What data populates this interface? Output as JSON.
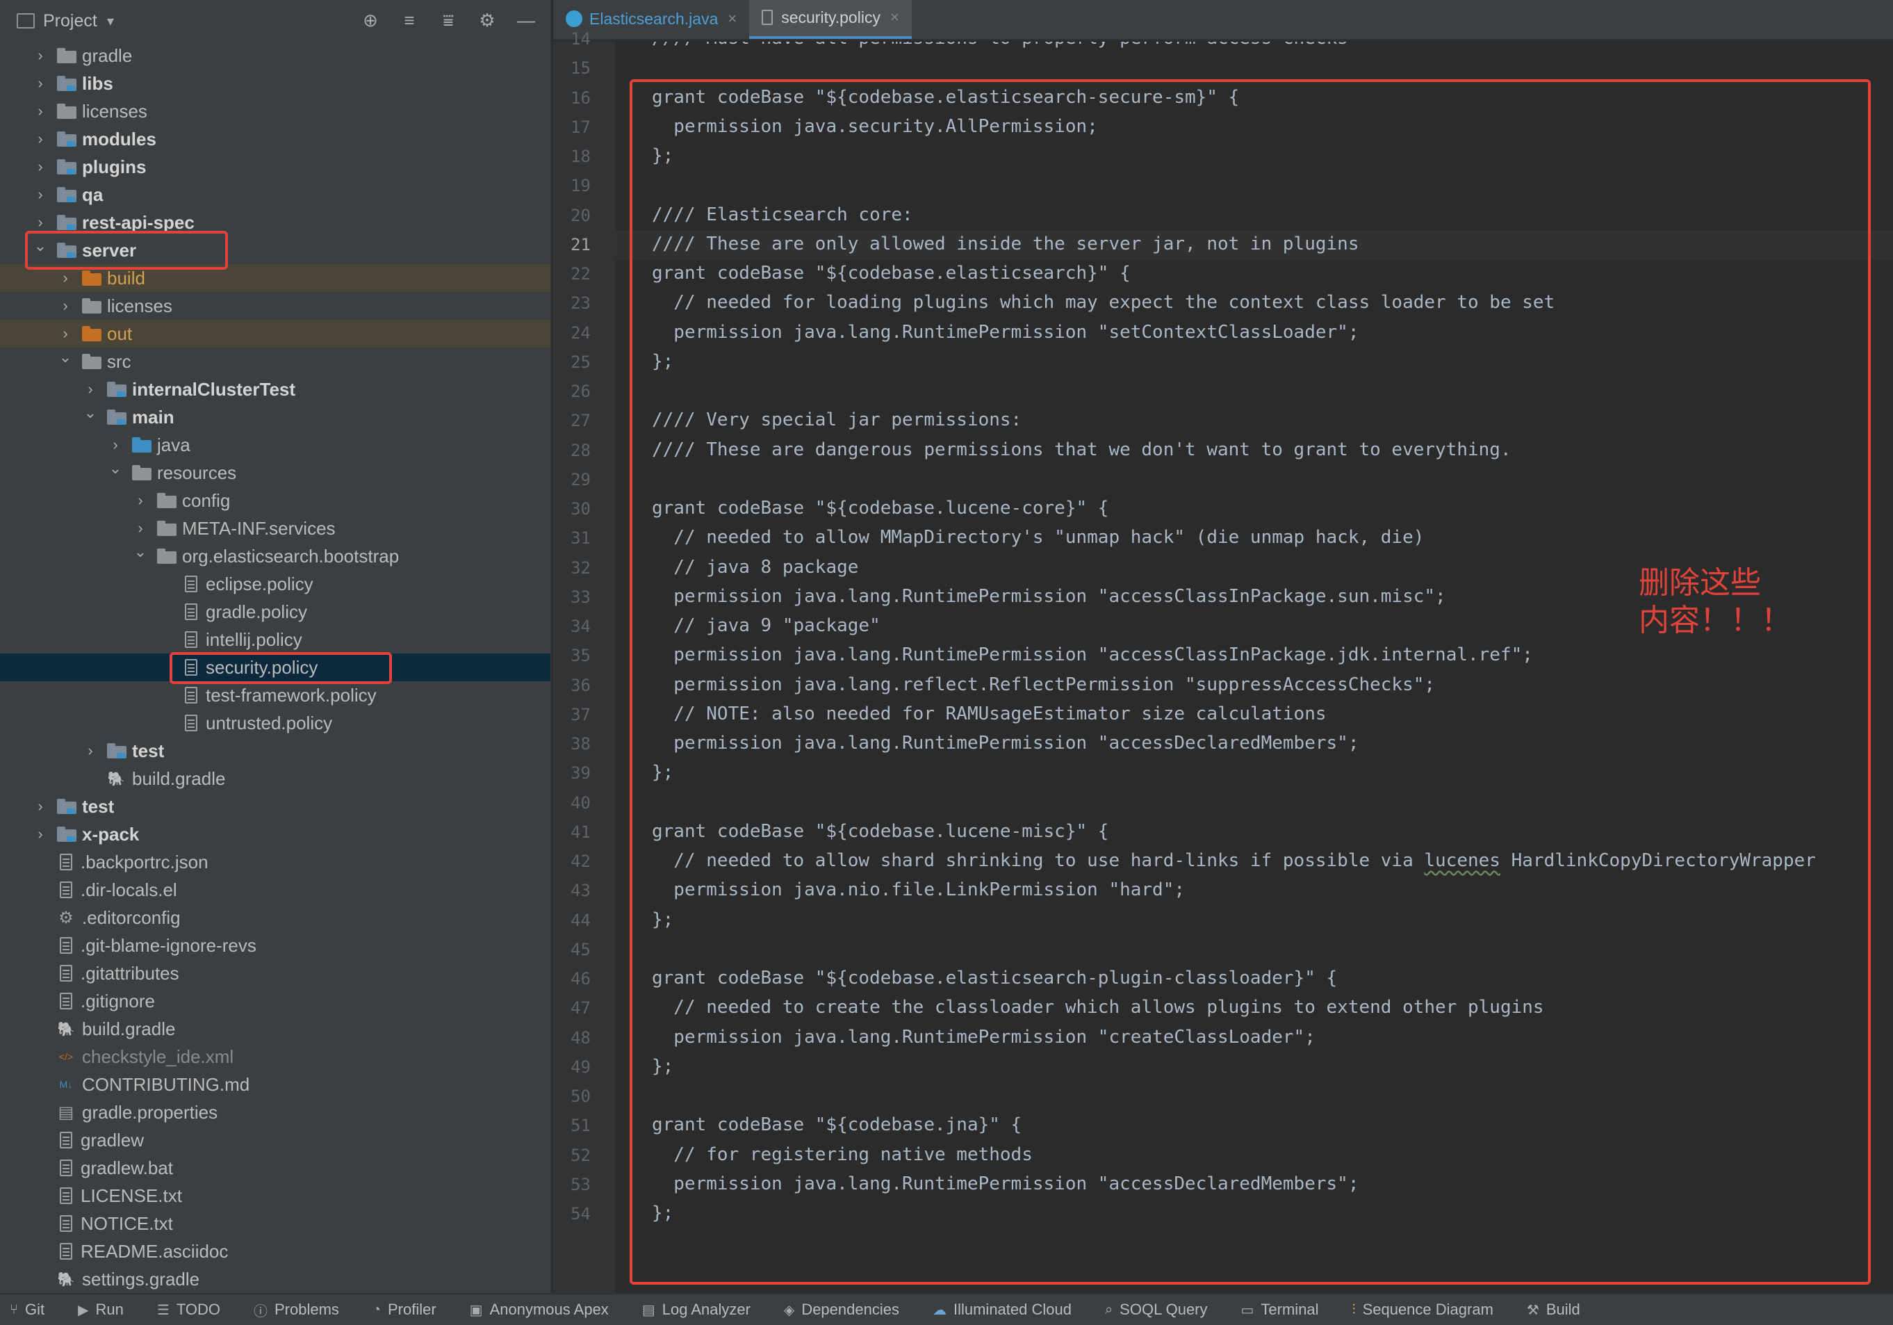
{
  "project_panel": {
    "title": "Project",
    "tree": [
      {
        "label": "gradle",
        "depth": 0,
        "kind": "folder",
        "expand": "closed"
      },
      {
        "label": "libs",
        "depth": 0,
        "kind": "module",
        "expand": "closed",
        "bold": true
      },
      {
        "label": "licenses",
        "depth": 0,
        "kind": "folder",
        "expand": "closed"
      },
      {
        "label": "modules",
        "depth": 0,
        "kind": "module",
        "expand": "closed",
        "bold": true
      },
      {
        "label": "plugins",
        "depth": 0,
        "kind": "module",
        "expand": "closed",
        "bold": true
      },
      {
        "label": "qa",
        "depth": 0,
        "kind": "module",
        "expand": "closed",
        "bold": true
      },
      {
        "label": "rest-api-spec",
        "depth": 0,
        "kind": "module",
        "expand": "closed",
        "bold": true
      },
      {
        "label": "server",
        "depth": 0,
        "kind": "module",
        "expand": "open",
        "bold": true
      },
      {
        "label": "build",
        "depth": 1,
        "kind": "orange",
        "expand": "closed",
        "excluded": true
      },
      {
        "label": "licenses",
        "depth": 1,
        "kind": "folder",
        "expand": "closed"
      },
      {
        "label": "out",
        "depth": 1,
        "kind": "orange",
        "expand": "closed",
        "excluded": true
      },
      {
        "label": "src",
        "depth": 1,
        "kind": "folder",
        "expand": "open"
      },
      {
        "label": "internalClusterTest",
        "depth": 2,
        "kind": "module",
        "expand": "closed",
        "bold": true
      },
      {
        "label": "main",
        "depth": 2,
        "kind": "module",
        "expand": "open",
        "bold": true
      },
      {
        "label": "java",
        "depth": 3,
        "kind": "blue",
        "expand": "closed"
      },
      {
        "label": "resources",
        "depth": 3,
        "kind": "folder",
        "expand": "open"
      },
      {
        "label": "config",
        "depth": 4,
        "kind": "folder",
        "expand": "closed"
      },
      {
        "label": "META-INF.services",
        "depth": 4,
        "kind": "folder",
        "expand": "closed"
      },
      {
        "label": "org.elasticsearch.bootstrap",
        "depth": 4,
        "kind": "folder",
        "expand": "open"
      },
      {
        "label": "eclipse.policy",
        "depth": 5,
        "kind": "file"
      },
      {
        "label": "gradle.policy",
        "depth": 5,
        "kind": "file"
      },
      {
        "label": "intellij.policy",
        "depth": 5,
        "kind": "file"
      },
      {
        "label": "security.policy",
        "depth": 5,
        "kind": "file",
        "selected": true
      },
      {
        "label": "test-framework.policy",
        "depth": 5,
        "kind": "file"
      },
      {
        "label": "untrusted.policy",
        "depth": 5,
        "kind": "file"
      },
      {
        "label": "test",
        "depth": 2,
        "kind": "module",
        "expand": "closed",
        "bold": true
      },
      {
        "label": "build.gradle",
        "depth": 2,
        "kind": "gradle"
      },
      {
        "label": "test",
        "depth": 0,
        "kind": "module",
        "expand": "closed",
        "bold": true
      },
      {
        "label": "x-pack",
        "depth": 0,
        "kind": "module",
        "expand": "closed",
        "bold": true
      },
      {
        "label": ".backportrc.json",
        "depth": 0,
        "kind": "file"
      },
      {
        "label": ".dir-locals.el",
        "depth": 0,
        "kind": "file"
      },
      {
        "label": ".editorconfig",
        "depth": 0,
        "kind": "gear"
      },
      {
        "label": ".git-blame-ignore-revs",
        "depth": 0,
        "kind": "file"
      },
      {
        "label": ".gitattributes",
        "depth": 0,
        "kind": "file"
      },
      {
        "label": ".gitignore",
        "depth": 0,
        "kind": "file"
      },
      {
        "label": "build.gradle",
        "depth": 0,
        "kind": "gradle"
      },
      {
        "label": "checkstyle_ide.xml",
        "depth": 0,
        "kind": "xml",
        "dim": true
      },
      {
        "label": "CONTRIBUTING.md",
        "depth": 0,
        "kind": "md"
      },
      {
        "label": "gradle.properties",
        "depth": 0,
        "kind": "props"
      },
      {
        "label": "gradlew",
        "depth": 0,
        "kind": "file"
      },
      {
        "label": "gradlew.bat",
        "depth": 0,
        "kind": "file"
      },
      {
        "label": "LICENSE.txt",
        "depth": 0,
        "kind": "file"
      },
      {
        "label": "NOTICE.txt",
        "depth": 0,
        "kind": "file"
      },
      {
        "label": "README.asciidoc",
        "depth": 0,
        "kind": "file"
      },
      {
        "label": "settings.gradle",
        "depth": 0,
        "kind": "gradle"
      }
    ]
  },
  "tabs": [
    {
      "label": "Elasticsearch.java",
      "active": false,
      "icon": "java-class-icon"
    },
    {
      "label": "security.policy",
      "active": true,
      "icon": "file-icon"
    }
  ],
  "editor": {
    "current_line": 21,
    "lines": [
      {
        "n": 14,
        "text": "//// Must have all permissions to properly perform access checks"
      },
      {
        "n": 15,
        "text": ""
      },
      {
        "n": 16,
        "text": "grant codeBase \"${codebase.elasticsearch-secure-sm}\" {"
      },
      {
        "n": 17,
        "text": "  permission java.security.AllPermission;"
      },
      {
        "n": 18,
        "text": "};"
      },
      {
        "n": 19,
        "text": ""
      },
      {
        "n": 20,
        "text": "//// Elasticsearch core:"
      },
      {
        "n": 21,
        "text": "//// These are only allowed inside the server jar, not in plugins"
      },
      {
        "n": 22,
        "text": "grant codeBase \"${codebase.elasticsearch}\" {"
      },
      {
        "n": 23,
        "text": "  // needed for loading plugins which may expect the context class loader to be set"
      },
      {
        "n": 24,
        "text": "  permission java.lang.RuntimePermission \"setContextClassLoader\";"
      },
      {
        "n": 25,
        "text": "};"
      },
      {
        "n": 26,
        "text": ""
      },
      {
        "n": 27,
        "text": "//// Very special jar permissions:"
      },
      {
        "n": 28,
        "text": "//// These are dangerous permissions that we don't want to grant to everything."
      },
      {
        "n": 29,
        "text": ""
      },
      {
        "n": 30,
        "text": "grant codeBase \"${codebase.lucene-core}\" {"
      },
      {
        "n": 31,
        "text": "  // needed to allow MMapDirectory's \"unmap hack\" (die unmap hack, die)"
      },
      {
        "n": 32,
        "text": "  // java 8 package"
      },
      {
        "n": 33,
        "text": "  permission java.lang.RuntimePermission \"accessClassInPackage.sun.misc\";"
      },
      {
        "n": 34,
        "text": "  // java 9 \"package\""
      },
      {
        "n": 35,
        "text": "  permission java.lang.RuntimePermission \"accessClassInPackage.jdk.internal.ref\";"
      },
      {
        "n": 36,
        "text": "  permission java.lang.reflect.ReflectPermission \"suppressAccessChecks\";"
      },
      {
        "n": 37,
        "text": "  // NOTE: also needed for RAMUsageEstimator size calculations"
      },
      {
        "n": 38,
        "text": "  permission java.lang.RuntimePermission \"accessDeclaredMembers\";"
      },
      {
        "n": 39,
        "text": "};"
      },
      {
        "n": 40,
        "text": ""
      },
      {
        "n": 41,
        "text": "grant codeBase \"${codebase.lucene-misc}\" {"
      },
      {
        "n": 42,
        "text": "  // needed to allow shard shrinking to use hard-links if possible via lucenes HardlinkCopyDirectoryWrapper"
      },
      {
        "n": 43,
        "text": "  permission java.nio.file.LinkPermission \"hard\";"
      },
      {
        "n": 44,
        "text": "};"
      },
      {
        "n": 45,
        "text": ""
      },
      {
        "n": 46,
        "text": "grant codeBase \"${codebase.elasticsearch-plugin-classloader}\" {"
      },
      {
        "n": 47,
        "text": "  // needed to create the classloader which allows plugins to extend other plugins"
      },
      {
        "n": 48,
        "text": "  permission java.lang.RuntimePermission \"createClassLoader\";"
      },
      {
        "n": 49,
        "text": "};"
      },
      {
        "n": 50,
        "text": ""
      },
      {
        "n": 51,
        "text": "grant codeBase \"${codebase.jna}\" {"
      },
      {
        "n": 52,
        "text": "  // for registering native methods"
      },
      {
        "n": 53,
        "text": "  permission java.lang.RuntimePermission \"accessDeclaredMembers\";"
      },
      {
        "n": 54,
        "text": "};"
      }
    ],
    "annotation_line1": "删除这些",
    "annotation_line2": "内容！！！"
  },
  "bottom_bar": [
    {
      "label": "Git",
      "icon": "git-branch-icon"
    },
    {
      "label": "Run",
      "icon": "run-icon"
    },
    {
      "label": "TODO",
      "icon": "list-icon"
    },
    {
      "label": "Problems",
      "icon": "info-icon"
    },
    {
      "label": "Profiler",
      "icon": "profiler-icon"
    },
    {
      "label": "Anonymous Apex",
      "icon": "apex-icon"
    },
    {
      "label": "Log Analyzer",
      "icon": "log-icon"
    },
    {
      "label": "Dependencies",
      "icon": "layers-icon"
    },
    {
      "label": "Illuminated Cloud",
      "icon": "cloud-icon"
    },
    {
      "label": "SOQL Query",
      "icon": "query-icon"
    },
    {
      "label": "Terminal",
      "icon": "terminal-icon"
    },
    {
      "label": "Sequence Diagram",
      "icon": "sequence-icon"
    },
    {
      "label": "Build",
      "icon": "hammer-icon"
    }
  ]
}
